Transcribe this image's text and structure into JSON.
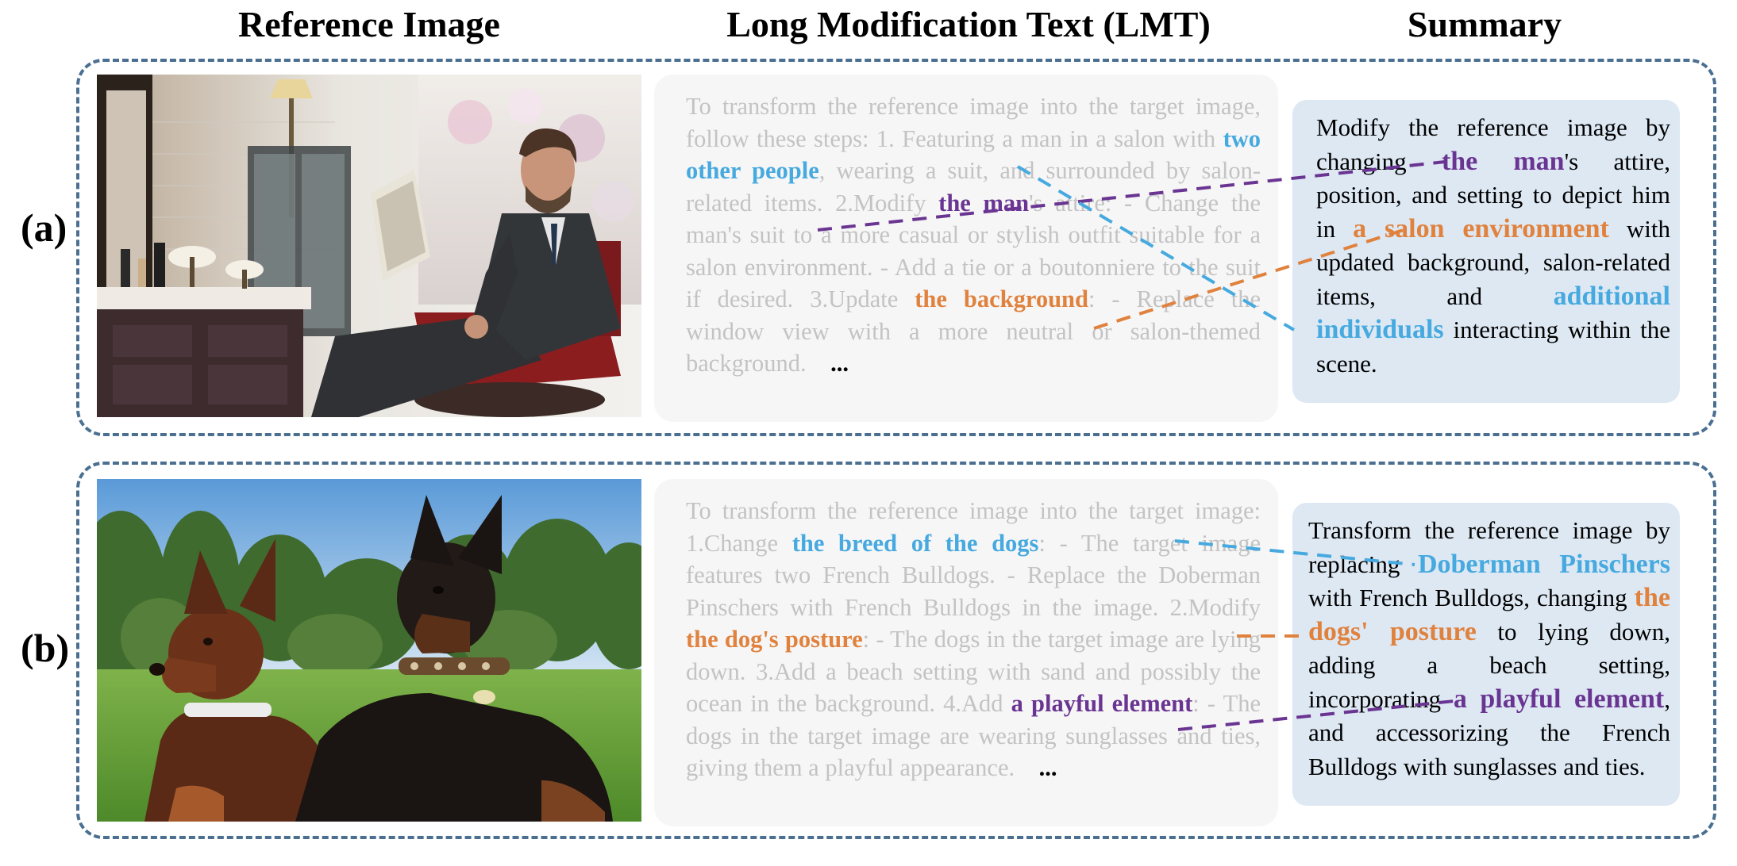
{
  "headers": {
    "ref": "Reference Image",
    "lmt": "Long Modification Text (LMT)",
    "summary": "Summary"
  },
  "colors": {
    "purple": "#6a3592",
    "orange": "#e0823e",
    "blue": "#46a9df",
    "frame": "#4a6f91"
  },
  "panels": [
    {
      "label": "(a)",
      "image_desc": "bearded man in suit reading a magazine in a salon chair",
      "lmt": {
        "s1": "To transform the reference image into the target image, follow these steps:  1. Featuring a man in a salon with ",
        "h1": "two other people",
        "s2": ", wearing a suit, and surrounded by salon-related items.  2.Modify ",
        "h2": "the man",
        "s3": "'s attire:  - Change the man's suit to a more casual or stylish outfit suitable for a salon environment.  - Add a tie or a boutonniere to the suit if desired.  3.Update ",
        "h3": "the background",
        "s4": ":  - Replace the window view with a more neutral or salon-themed background.",
        "ellipsis": "..."
      },
      "summary": {
        "s1": "Modify the reference image by changing ",
        "h1": "the man",
        "s2": "'s attire, position, and setting to depict him in ",
        "h2": "a salon environment",
        "s3": " with updated background, salon-related items, and ",
        "h3": "additional individuals",
        "s4": " interacting within the scene."
      }
    },
    {
      "label": "(b)",
      "image_desc": "two Doberman Pinschers sitting on grass",
      "lmt": {
        "s1": "To transform the reference image into the target image:  1.Change ",
        "h1": "the breed of the dogs",
        "s2": ":  - The target image features two French Bulldogs.   - Replace the Doberman Pinschers with French Bulldogs in the image.  2.Modify ",
        "h2": "the dog's posture",
        "s3": ":  - The dogs in the target image are lying down.  3.Add a beach setting with sand and possibly the ocean in the background.  4.Add ",
        "h3": "a playful element",
        "s4": ":  - The dogs in the target image are wearing sunglasses and ties, giving them a playful appearance.",
        "ellipsis": "..."
      },
      "summary": {
        "s1": "Transform the reference image by replacing ",
        "h1": "Doberman Pinschers",
        "s2": " with French Bulldogs, changing ",
        "h2": "the dogs' posture",
        "s3": " to lying down, adding a beach setting, incorporating ",
        "h3": "a playful element",
        "s4": ", and accessorizing the French Bulldogs with sunglasses and ties."
      }
    }
  ]
}
